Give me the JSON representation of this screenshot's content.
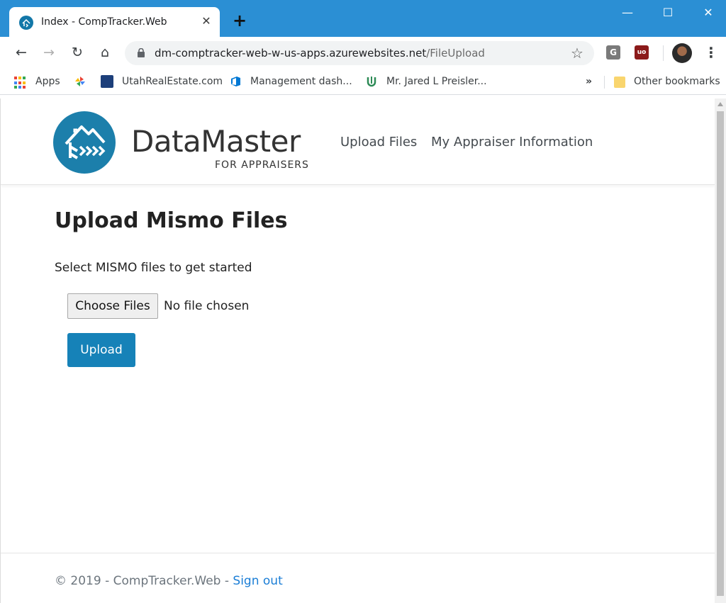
{
  "browser": {
    "tab": {
      "title": "Index - CompTracker.Web",
      "close_glyph": "✕"
    },
    "new_tab_glyph": "+",
    "window_controls": {
      "minimize": "—",
      "maximize": "☐",
      "close": "✕"
    },
    "address": {
      "host": "dm-comptracker-web-w-us-apps.azurewebsites.net",
      "path": "/FileUpload"
    },
    "extensions": [
      {
        "name": "grammarly-icon",
        "letter": "G",
        "color": "#7a7a7a"
      },
      {
        "name": "ublock-icon",
        "letter": "uo",
        "color": "#8b1a1a"
      }
    ],
    "bookmarks": [
      {
        "label": "Apps"
      },
      {
        "label": ""
      },
      {
        "label": "UtahRealEstate.com"
      },
      {
        "label": "Management dash..."
      },
      {
        "label": "Mr. Jared L Preisler..."
      }
    ],
    "bookmarks_overflow": "»",
    "other_bookmarks": "Other bookmarks"
  },
  "site": {
    "logo": {
      "wordmark": "DataMaster",
      "tagline": "FOR APPRAISERS"
    },
    "nav": [
      {
        "label": "Upload Files"
      },
      {
        "label": "My Appraiser Information"
      }
    ],
    "brand_color": "#1682b8"
  },
  "main": {
    "title": "Upload Mismo Files",
    "intro": "Select MISMO files to get started",
    "file_input": {
      "button_label": "Choose Files",
      "status": "No file chosen"
    },
    "upload_label": "Upload"
  },
  "footer": {
    "text": "© 2019 - CompTracker.Web - ",
    "sign_out": "Sign out"
  }
}
